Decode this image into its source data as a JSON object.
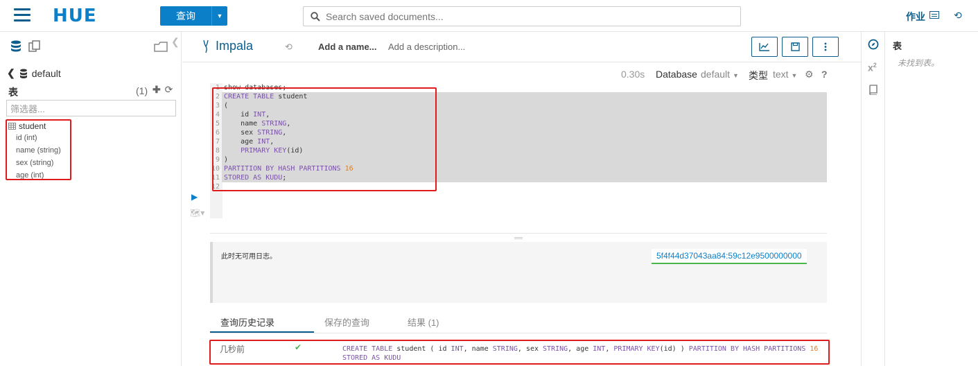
{
  "topbar": {
    "logo": "HUE",
    "query_button": "查询",
    "search_placeholder": "Search saved documents...",
    "jobs_label": "作业"
  },
  "left_panel": {
    "database": "default",
    "tables_label": "表",
    "tables_count": "(1)",
    "filter_placeholder": "筛选器...",
    "table": {
      "name": "student",
      "columns": [
        "id (int)",
        "name (string)",
        "sex (string)",
        "age (int)"
      ]
    }
  },
  "editor_header": {
    "engine": "Impala",
    "name_placeholder": "Add a name...",
    "description_placeholder": "Add a description..."
  },
  "snippet_bar": {
    "exec_time": "0.30s",
    "database_label": "Database",
    "database_value": "default",
    "type_label": "类型",
    "type_value": "text",
    "help": "?"
  },
  "code_lines": [
    "show databases;",
    "CREATE TABLE student",
    "(",
    "    id INT,",
    "    name STRING,",
    "    sex STRING,",
    "    age INT,",
    "    PRIMARY KEY(id)",
    ")",
    "PARTITION BY HASH PARTITIONS 16",
    "STORED AS KUDU;",
    ""
  ],
  "log": {
    "text": "此时无可用日志。",
    "query_id": "5f4f44d37043aa84:59c12e9500000000"
  },
  "tabs": [
    "查询历史记录",
    "保存的查询",
    "结果 (1)"
  ],
  "history": {
    "time": "几秒前",
    "sql": "CREATE TABLE student ( id INT, name STRING, sex STRING, age INT, PRIMARY KEY(id) ) PARTITION BY HASH PARTITIONS 16 STORED AS KUDU"
  },
  "right_panel": {
    "title": "表",
    "empty": "未找到表。"
  },
  "colors": {
    "brand": "#0b7fc7",
    "dark_brand": "#0b5e8c",
    "annotation": "#e01b1b",
    "success": "#4bb649"
  }
}
